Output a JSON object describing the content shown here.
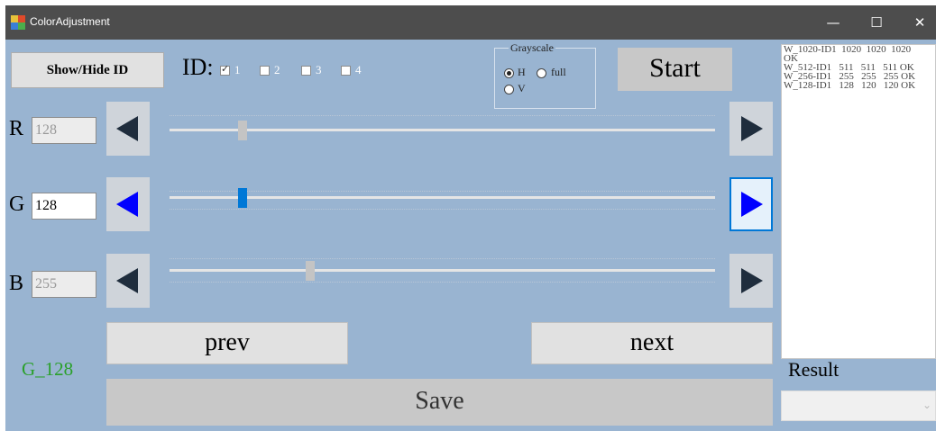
{
  "window": {
    "title": "ColorAdjustment",
    "minimize": "—",
    "maximize": "☐",
    "close": "✕"
  },
  "toolbar": {
    "show_hide_label": "Show/Hide ID",
    "id_label": "ID:",
    "ids": [
      {
        "label": "1",
        "checked": true
      },
      {
        "label": "2",
        "checked": false
      },
      {
        "label": "3",
        "checked": false
      },
      {
        "label": "4",
        "checked": false
      }
    ],
    "start_label": "Start"
  },
  "grayscale": {
    "title": "Grayscale",
    "options": [
      {
        "label": "H",
        "selected": true
      },
      {
        "label": "full",
        "selected": false
      },
      {
        "label": "V",
        "selected": false
      }
    ]
  },
  "channels": {
    "r": {
      "label": "R",
      "value": "128",
      "level": 128,
      "max": 1023
    },
    "g": {
      "label": "G",
      "value": "128",
      "level": 128,
      "max": 1023
    },
    "b": {
      "label": "B",
      "value": "255",
      "level": 255,
      "max": 1023
    }
  },
  "status": {
    "current": "G_128"
  },
  "buttons": {
    "prev": "prev",
    "next": "next",
    "save": "Save"
  },
  "log": {
    "lines": [
      "W_1020-ID1  1020  1020  1020",
      "OK",
      "W_512-ID1   511   511   511 OK",
      "W_256-ID1   255   255   255 OK",
      "W_128-ID1   128   120   120 OK"
    ]
  },
  "result": {
    "label": "Result",
    "value": ""
  },
  "colors": {
    "background": "#99b4d1",
    "titlebar": "#4d4d4d",
    "accent": "#0078d7",
    "status_green": "#2aa02a"
  }
}
